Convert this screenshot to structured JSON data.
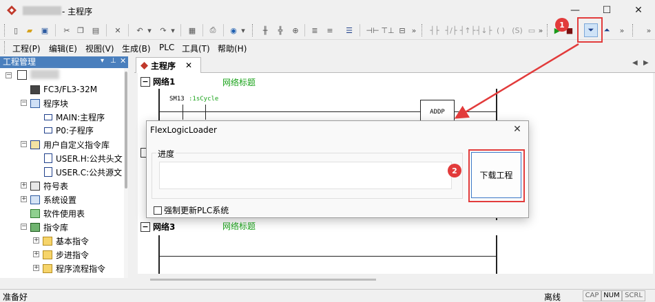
{
  "app": {
    "title": "- 主程序",
    "window_controls": {
      "minimize": "—",
      "maximize": "☐",
      "close": "✕"
    }
  },
  "menu": [
    "工程(P)",
    "编辑(E)",
    "视图(V)",
    "生成(B)",
    "PLC",
    "工具(T)",
    "帮助(H)"
  ],
  "project_panel": {
    "title": "工程管理",
    "tree": [
      {
        "label": "FC3/FL3-32M",
        "icon": "plc-device-icon"
      },
      {
        "label": "程序块",
        "icon": "program-block-icon"
      },
      {
        "label": "MAIN:主程序",
        "icon": "program-file-icon"
      },
      {
        "label": "P0:子程序",
        "icon": "program-file-icon"
      },
      {
        "label": "用户自定义指令库",
        "icon": "library-icon"
      },
      {
        "label": "USER.H:公共头文",
        "icon": "header-file-icon"
      },
      {
        "label": "USER.C:公共源文",
        "icon": "source-file-icon"
      },
      {
        "label": "符号表",
        "icon": "symbol-table-icon"
      },
      {
        "label": "系统设置",
        "icon": "settings-grid-icon"
      },
      {
        "label": "软件使用表",
        "icon": "usage-table-icon"
      },
      {
        "label": "指令库",
        "icon": "instruction-library-icon"
      },
      {
        "label": "基本指令",
        "icon": "folder-icon"
      },
      {
        "label": "步进指令",
        "icon": "folder-icon"
      },
      {
        "label": "程序流程指令",
        "icon": "folder-icon"
      }
    ]
  },
  "editor": {
    "tab_label": "主程序",
    "networks": [
      {
        "head": "网络1",
        "title": "网络标题",
        "contact": "SM13",
        "contact_comment": ":1sCycle",
        "block": "ADDP"
      },
      {
        "head": "网络3",
        "title": "网络标题"
      }
    ]
  },
  "dialog": {
    "title": "FlexLogicLoader",
    "group_label": "进度",
    "progress": 0,
    "download_button": "下载工程",
    "checkbox_label": "强制更新PLC系统",
    "checkbox_checked": false
  },
  "annotations": {
    "badge1": "1",
    "badge2": "2",
    "color": "#e23b3b"
  },
  "status": {
    "left": "准备好",
    "mode": "离线",
    "keys": [
      "CAP",
      "NUM",
      "SCRL"
    ]
  }
}
